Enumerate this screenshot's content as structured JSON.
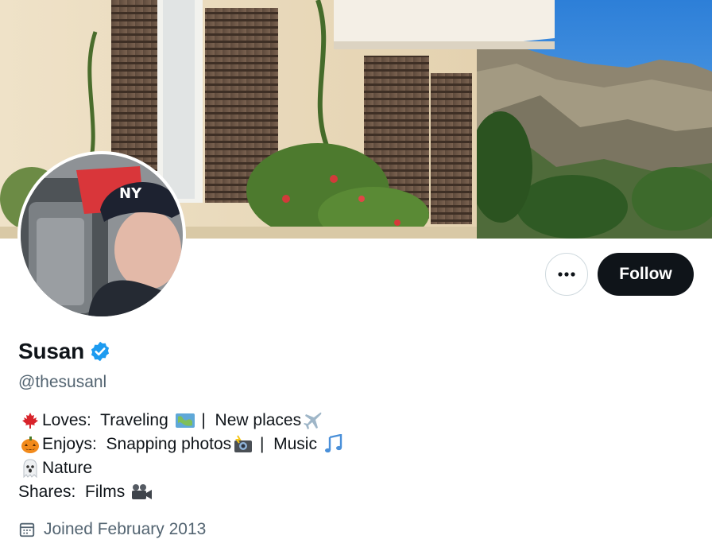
{
  "profile": {
    "name": "Susan",
    "handle": "@thesusanl",
    "follow_label": "Follow",
    "more_label": "•••",
    "joined": "Joined February 2013"
  },
  "bio": {
    "line1": {
      "emoji": "maple-leaf-icon",
      "text_a": "Loves:  Traveling ",
      "emoji2": "world-map-icon",
      "text_b": " |  New places",
      "emoji3": "airplane-icon"
    },
    "line2": {
      "emoji": "jack-o-lantern-icon",
      "text_a": "Enjoys:  Snapping photos",
      "emoji2": "camera-flash-icon",
      "text_b": " |  Music ",
      "emoji3": "music-notes-icon"
    },
    "line3": {
      "emoji": "ghost-icon",
      "text_a": "Nature"
    },
    "line4": {
      "text_a": "Shares:  Films ",
      "emoji2": "movie-camera-icon"
    }
  },
  "colors": {
    "verified": "#1d9bf0",
    "follow_bg": "#0f1419",
    "secondary_text": "#536471"
  }
}
